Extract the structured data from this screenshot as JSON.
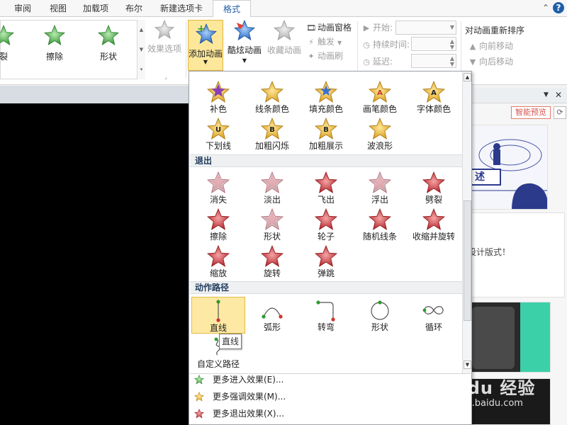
{
  "tabs": [
    {
      "label": "审阅",
      "active": false
    },
    {
      "label": "视图",
      "active": false
    },
    {
      "label": "加载项",
      "active": false
    },
    {
      "label": "布尔",
      "active": false
    },
    {
      "label": "新建选项卡",
      "active": false
    },
    {
      "label": "格式",
      "active": true
    }
  ],
  "ribbon": {
    "gallery": [
      {
        "label": "裂",
        "icon": "split-star-icon"
      },
      {
        "label": "擦除",
        "icon": "wipe-star-icon"
      },
      {
        "label": "形状",
        "icon": "shape-star-icon"
      }
    ],
    "effect_options": "效果选项",
    "add_animation": "添加动画",
    "cool_animation": "酷炫动画",
    "collect_animation": "收藏动画",
    "animation_pane": "动画窗格",
    "trigger": "触发",
    "animation_brush": "动画刷",
    "start_label": "开始:",
    "duration_label": "持续时间:",
    "delay_label": "延迟:",
    "reorder_title": "对动画重新排序",
    "move_earlier": "向前移动",
    "move_later": "向后移动"
  },
  "side_pane": {
    "smart_preview": "智能预览",
    "card_text_1": "述",
    "card_text_2": "设计版式！"
  },
  "dropdown": {
    "emphasis": [
      {
        "label": "补色",
        "icon": "complementary-color-star-icon"
      },
      {
        "label": "线条颜色",
        "icon": "line-color-star-icon"
      },
      {
        "label": "填充颜色",
        "icon": "fill-color-star-icon"
      },
      {
        "label": "画笔颜色",
        "icon": "brush-color-star-icon"
      },
      {
        "label": "字体颜色",
        "icon": "font-color-star-icon"
      },
      {
        "label": "下划线",
        "icon": "underline-star-icon"
      },
      {
        "label": "加粗闪烁",
        "icon": "bold-flash-star-icon"
      },
      {
        "label": "加粗展示",
        "icon": "bold-reveal-star-icon"
      },
      {
        "label": "波浪形",
        "icon": "wave-star-icon"
      }
    ],
    "exit_title": "退出",
    "exit": [
      {
        "label": "消失",
        "icon": "disappear-star-icon"
      },
      {
        "label": "淡出",
        "icon": "fade-out-star-icon"
      },
      {
        "label": "飞出",
        "icon": "fly-out-star-icon"
      },
      {
        "label": "浮出",
        "icon": "float-out-star-icon"
      },
      {
        "label": "劈裂",
        "icon": "split-out-star-icon"
      },
      {
        "label": "擦除",
        "icon": "wipe-out-star-icon"
      },
      {
        "label": "形状",
        "icon": "shape-out-star-icon"
      },
      {
        "label": "轮子",
        "icon": "wheel-out-star-icon"
      },
      {
        "label": "随机线条",
        "icon": "random-bars-star-icon"
      },
      {
        "label": "收缩并旋转",
        "icon": "shrink-turn-star-icon"
      },
      {
        "label": "缩放",
        "icon": "zoom-out-star-icon"
      },
      {
        "label": "旋转",
        "icon": "swivel-out-star-icon"
      },
      {
        "label": "弹跳",
        "icon": "bounce-out-star-icon"
      }
    ],
    "path_title": "动作路径",
    "paths": [
      {
        "label": "直线",
        "icon": "line-path-icon",
        "selected": true
      },
      {
        "label": "弧形",
        "icon": "arc-path-icon",
        "selected": false
      },
      {
        "label": "转弯",
        "icon": "turn-path-icon",
        "selected": false
      },
      {
        "label": "形状",
        "icon": "shape-path-icon",
        "selected": false
      },
      {
        "label": "循环",
        "icon": "loop-path-icon",
        "selected": false
      },
      {
        "label": "自定义路径",
        "icon": "custom-path-icon",
        "selected": false
      }
    ],
    "more_entrance": "更多进入效果(E)...",
    "more_emphasis": "更多强调效果(M)...",
    "more_exit": "更多退出效果(X)...",
    "tooltip": "直线"
  },
  "watermark": {
    "main": "Baidu 经验",
    "sub": "jingyan.baidu.com"
  },
  "colors": {
    "accent": "#1f5fa8",
    "selected_bg": "#fde9a3",
    "exit_red": "#c0392b",
    "emphasis_gold": "#e8b830",
    "entrance_green": "#3a9a3a"
  }
}
